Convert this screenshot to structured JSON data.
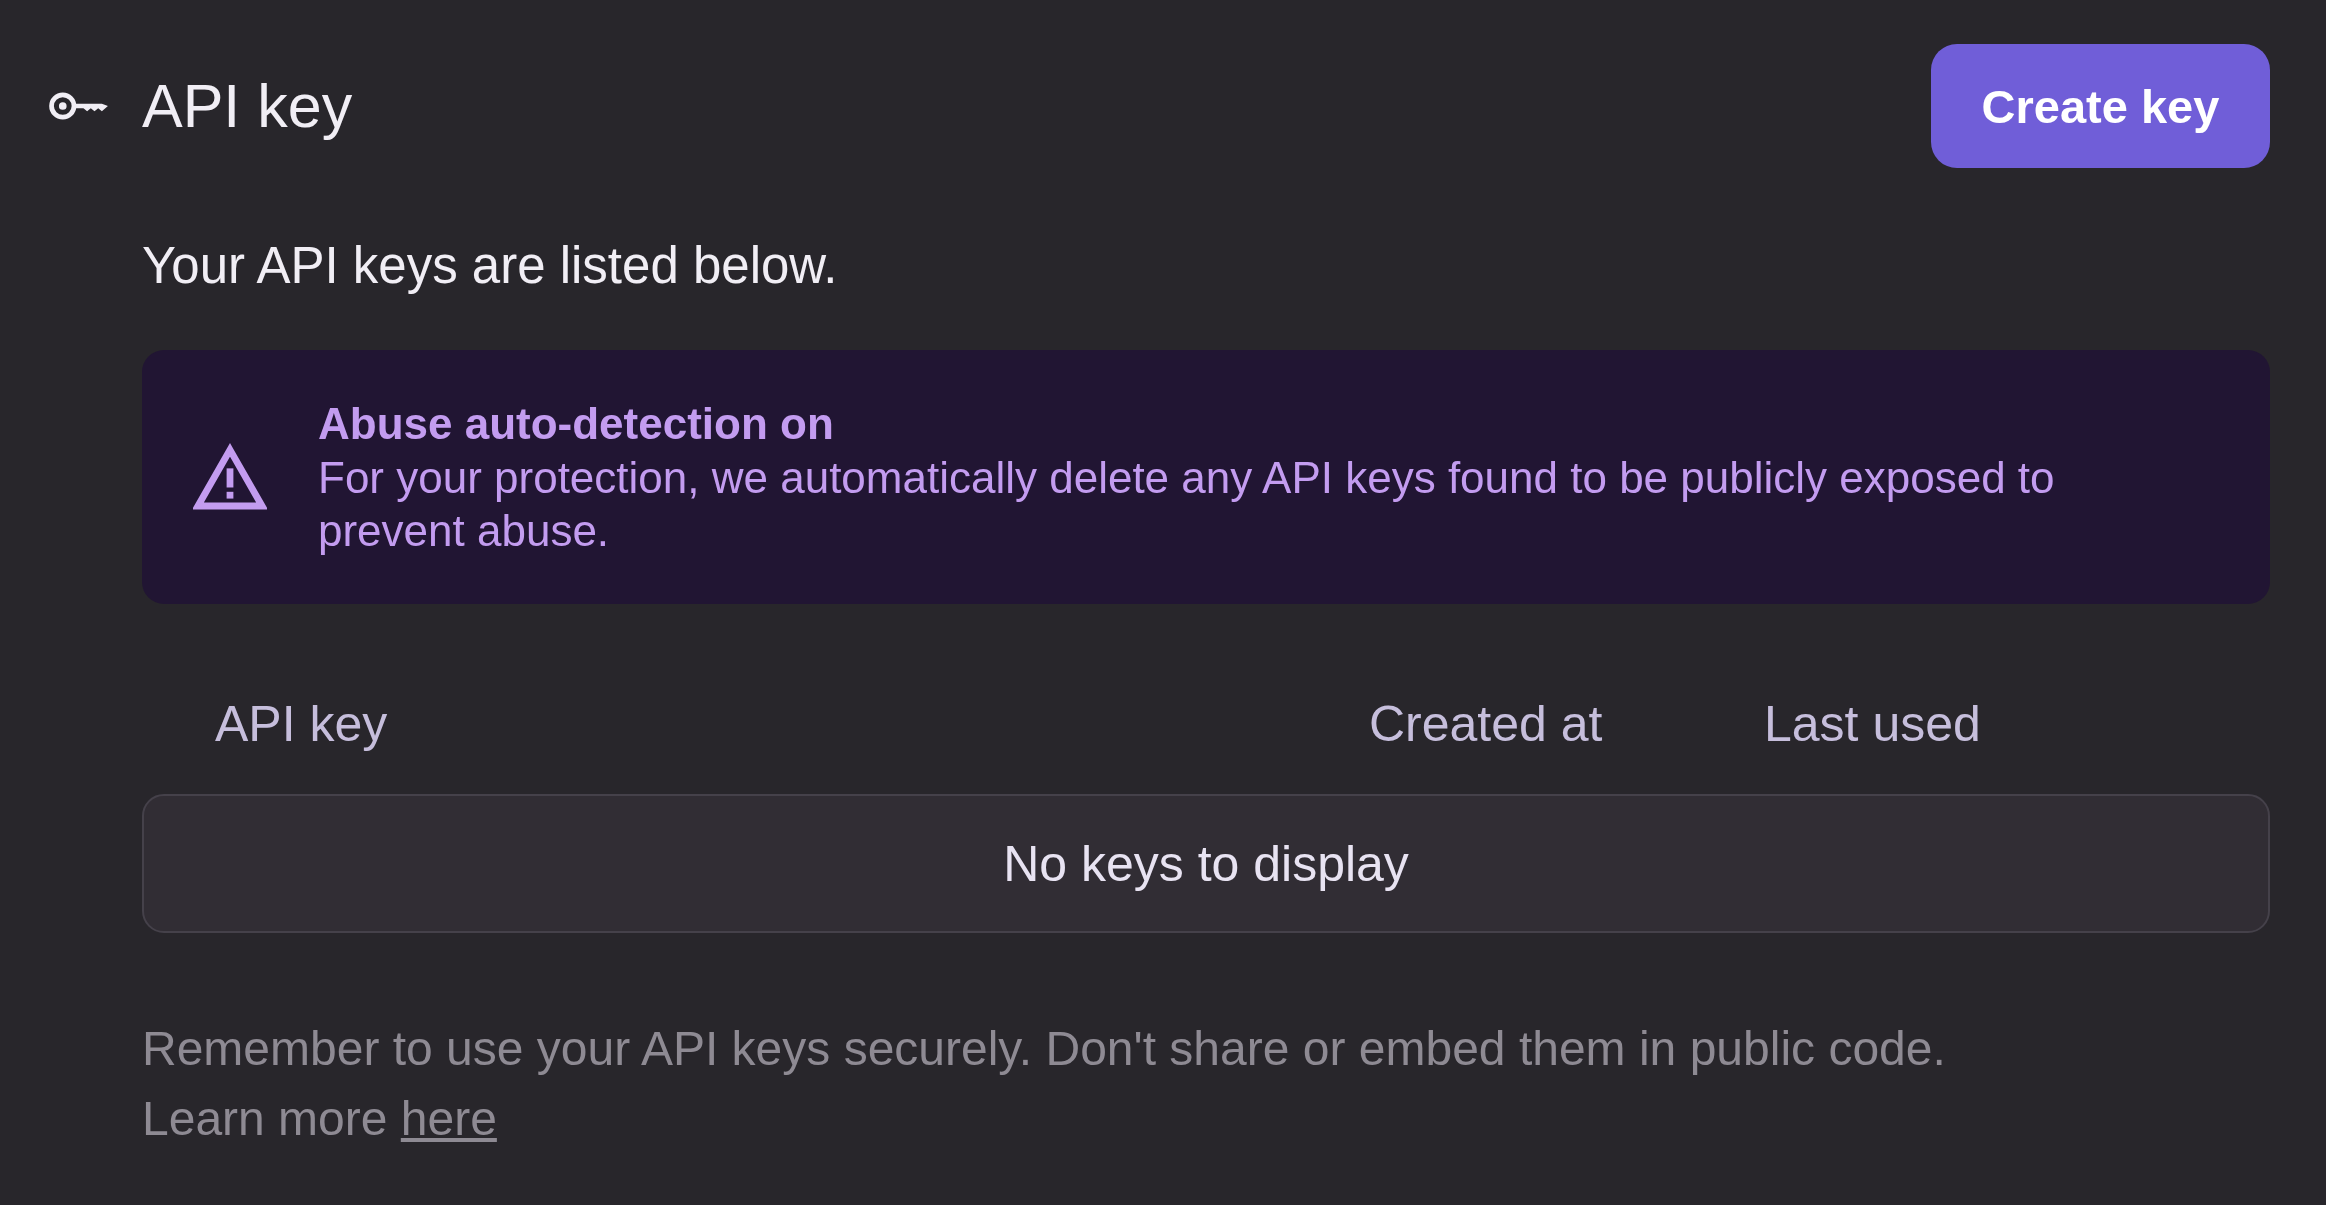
{
  "header": {
    "title": "API key",
    "create_button": "Create key"
  },
  "description": "Your API keys are listed below.",
  "alert": {
    "title": "Abuse auto-detection on",
    "message": "For your protection, we automatically delete any API keys found to be publicly exposed to prevent abuse."
  },
  "table": {
    "columns": [
      "API key",
      "Created at",
      "Last used"
    ],
    "empty_message": "No keys to display"
  },
  "footer": {
    "note": "Remember to use your API keys securely. Don't share or embed them in public code.",
    "learn_more": "Learn more",
    "link": "here"
  }
}
